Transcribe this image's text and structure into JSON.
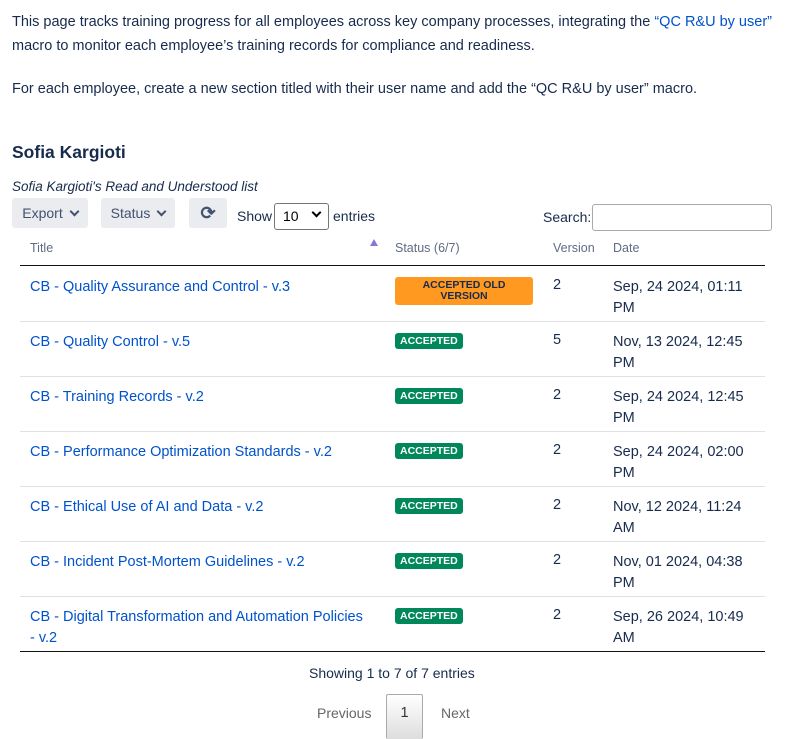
{
  "intro": {
    "p1_before": "This page tracks training progress for all employees across key company processes, integrating the ",
    "p1_link": "“QC R&U by user”",
    "p1_after": " macro to monitor each employee’s training records for compliance and readiness.",
    "p2": "For each employee, create a new section titled with their user name and add the “QC R&U by user” macro."
  },
  "section": {
    "title": "Sofia Kargioti",
    "caption": "Sofia Kargioti's Read and Understood list"
  },
  "toolbar": {
    "export": "Export",
    "status": "Status",
    "refresh_icon": "refresh-icon",
    "show": "Show",
    "page_size": "10",
    "entries": "entries",
    "search_label": "Search:",
    "search_value": ""
  },
  "columns": {
    "title": "Title",
    "status": "Status (6/7)",
    "version": "Version",
    "date": "Date"
  },
  "rows": [
    {
      "title": "CB - Quality Assurance and Control - v.3",
      "status": "ACCEPTED OLD VERSION",
      "old": true,
      "version": "2",
      "date": "Sep, 24 2024, 01:11 PM"
    },
    {
      "title": "CB - Quality Control - v.5",
      "status": "ACCEPTED",
      "version": "5",
      "date": "Nov, 13 2024, 12:45 PM"
    },
    {
      "title": "CB - Training Records - v.2",
      "status": "ACCEPTED",
      "version": "2",
      "date": "Sep, 24 2024, 12:45 PM"
    },
    {
      "title": "CB - Performance Optimization Standards - v.2",
      "status": "ACCEPTED",
      "version": "2",
      "date": "Sep, 24 2024, 02:00 PM"
    },
    {
      "title": "CB - Ethical Use of AI and Data - v.2",
      "status": "ACCEPTED",
      "version": "2",
      "date": "Nov, 12 2024, 11:24 AM"
    },
    {
      "title": "CB - Incident Post-Mortem Guidelines - v.2",
      "status": "ACCEPTED",
      "version": "2",
      "date": "Nov, 01 2024, 04:38 PM"
    },
    {
      "title": "CB - Digital Transformation and Automation Policies - v.2",
      "status": "ACCEPTED",
      "version": "2",
      "date": "Sep, 26 2024, 10:49 AM"
    }
  ],
  "footer": {
    "info": "Showing 1 to 7 of 7 entries",
    "previous": "Previous",
    "page": "1",
    "next": "Next"
  },
  "colors": {
    "link": "#0052cc",
    "accepted": "#00875a",
    "old": "#ff991f"
  }
}
